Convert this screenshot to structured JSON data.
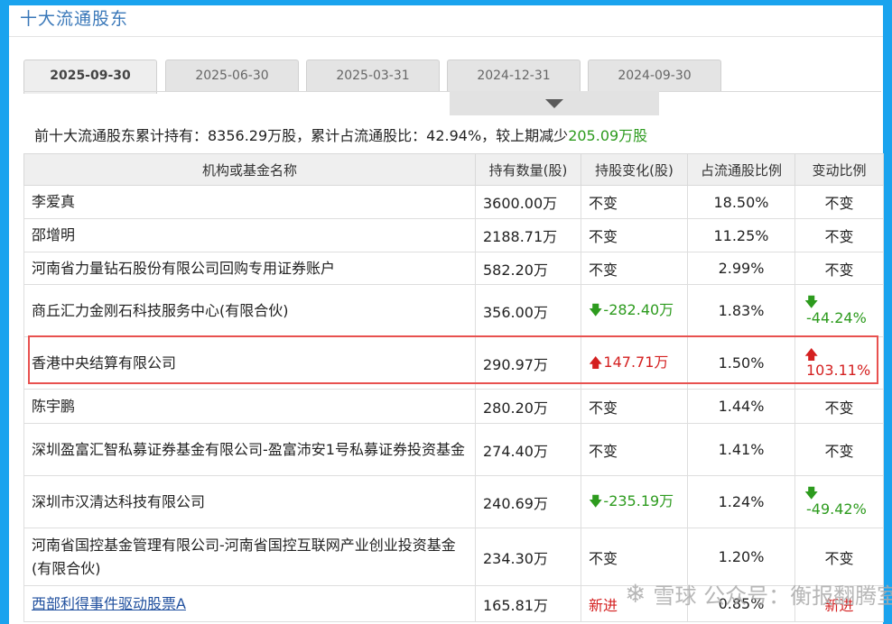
{
  "section": {
    "title": "十大流通股东"
  },
  "tabs": [
    {
      "label": "2025-09-30",
      "active": true
    },
    {
      "label": "2025-06-30",
      "active": false
    },
    {
      "label": "2025-03-31",
      "active": false
    },
    {
      "label": "2024-12-31",
      "active": false
    },
    {
      "label": "2024-09-30",
      "active": false
    }
  ],
  "summary": {
    "prefix": "前十大流通股东累计持有：8356.29万股，累计占流通股比：42.94%，较上期减少",
    "reduced": "205.09万股"
  },
  "table": {
    "headers": [
      "机构或基金名称",
      "持有数量(股)",
      "持股变化(股)",
      "占流通股比例",
      "变动比例"
    ],
    "rows": [
      {
        "name": "李爱真",
        "qty": "3600.00万",
        "change": "不变",
        "change_dir": "none",
        "pct": "18.50%",
        "ratio": "不变",
        "ratio_dir": "none"
      },
      {
        "name": "邵增明",
        "qty": "2188.71万",
        "change": "不变",
        "change_dir": "none",
        "pct": "11.25%",
        "ratio": "不变",
        "ratio_dir": "none"
      },
      {
        "name": "河南省力量钻石股份有限公司回购专用证券账户",
        "qty": "582.20万",
        "change": "不变",
        "change_dir": "none",
        "pct": "2.99%",
        "ratio": "不变",
        "ratio_dir": "none"
      },
      {
        "name": "商丘汇力金刚石科技服务中心(有限合伙)",
        "qty": "356.00万",
        "change": "-282.40万",
        "change_dir": "down",
        "pct": "1.83%",
        "ratio": "-44.24%",
        "ratio_dir": "down"
      },
      {
        "name": "香港中央结算有限公司",
        "qty": "290.97万",
        "change": "147.71万",
        "change_dir": "up",
        "pct": "1.50%",
        "ratio": "103.11%",
        "ratio_dir": "up"
      },
      {
        "name": "陈宇鹏",
        "qty": "280.20万",
        "change": "不变",
        "change_dir": "none",
        "pct": "1.44%",
        "ratio": "不变",
        "ratio_dir": "none"
      },
      {
        "name": "深圳盈富汇智私募证券基金有限公司-盈富沛安1号私募证券投资基金",
        "qty": "274.40万",
        "change": "不变",
        "change_dir": "none",
        "pct": "1.41%",
        "ratio": "不变",
        "ratio_dir": "none"
      },
      {
        "name": "深圳市汉清达科技有限公司",
        "qty": "240.69万",
        "change": "-235.19万",
        "change_dir": "down",
        "pct": "1.24%",
        "ratio": "-49.42%",
        "ratio_dir": "down"
      },
      {
        "name": "河南省国控基金管理有限公司-河南省国控互联网产业创业投资基金(有限合伙)",
        "qty": "234.30万",
        "change": "不变",
        "change_dir": "none",
        "pct": "1.20%",
        "ratio": "不变",
        "ratio_dir": "none"
      },
      {
        "name": "西部利得事件驱动股票A",
        "qty": "165.81万",
        "change": "新进",
        "change_dir": "new",
        "pct": "0.85%",
        "ratio": "新进",
        "ratio_dir": "new",
        "link": true
      }
    ]
  },
  "watermark": {
    "text": "雪球 公众号：衡报翻腾室"
  },
  "colors": {
    "frame": "#1aa3ee",
    "down": "#2d9b1e",
    "up": "#d42020",
    "highlight": "#e8514f",
    "title": "#3a78b9"
  }
}
